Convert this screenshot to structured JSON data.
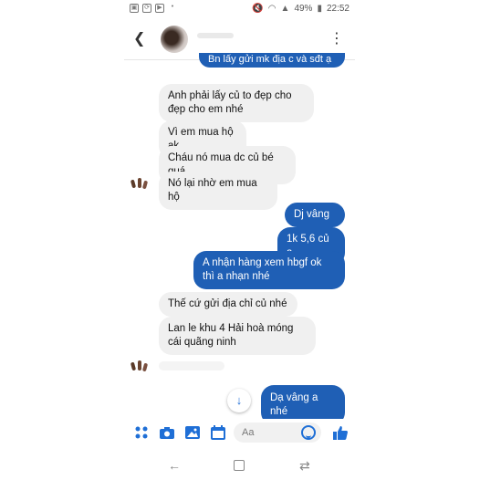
{
  "status_bar": {
    "battery": "49%",
    "time": "22:52"
  },
  "header": {
    "back_icon": "arrow-left-icon",
    "menu_icon": "vertical-ellipsis-icon"
  },
  "messages": [
    {
      "side": "out",
      "text": "Bn lấy gửi mk địa c và sđt ạ"
    },
    {
      "side": "in",
      "text": "Anh phải lấy củ to đẹp cho đẹp cho em nhé"
    },
    {
      "side": "in",
      "text": "Vì em mua hộ ak"
    },
    {
      "side": "in",
      "text": "Cháu nó mua dc củ bé quá"
    },
    {
      "side": "in",
      "text": "Nó lại nhờ em mua hộ"
    },
    {
      "side": "out",
      "text": "Dj vâng"
    },
    {
      "side": "out",
      "text": "1k 5,6 củ ạ"
    },
    {
      "side": "out",
      "text": "A nhận hàng xem hbgf ok thì a nhạn nhé"
    },
    {
      "side": "in",
      "text": "Thế cứ gửi địa chỉ củ nhé"
    },
    {
      "side": "in",
      "text": "Lan le khu 4 Hải hoà móng cái quãng ninh"
    },
    {
      "side": "out",
      "text": "Dạ vâng a nhé"
    }
  ],
  "composer": {
    "placeholder": "Aa",
    "icons": [
      "apps-icon",
      "camera-icon",
      "image-icon",
      "calendar-icon",
      "emoji-icon",
      "thumbs-up-icon"
    ]
  },
  "colors": {
    "accent": "#1f6fd6",
    "outgoing_bubble": "#1f5fb5",
    "incoming_bubble": "#f0f0f0"
  }
}
